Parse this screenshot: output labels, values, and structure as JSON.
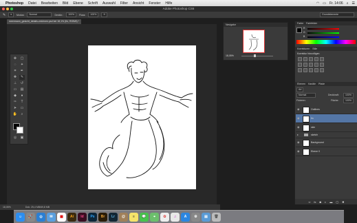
{
  "menubar": {
    "app": "Photoshop",
    "items": [
      "Datei",
      "Bearbeiten",
      "Bild",
      "Ebene",
      "Schrift",
      "Auswahl",
      "Filter",
      "Ansicht",
      "Fenster",
      "Hilfe"
    ],
    "clock": "Fr. 14:06"
  },
  "window_title": "Adobe Photoshop CS6",
  "options": {
    "modus_label": "Modus:",
    "modus_value": "Normal",
    "deckkraft_label": "Deckkr.:",
    "deckkraft_value": "100%",
    "fluss_label": "Fluss:",
    "fluss_value": "100%",
    "workspace": "Grundelemente"
  },
  "document_tab": "meermann_gesicht_details-zeichnen.psd bei 18,1% (fin, RGB/8) *",
  "status": {
    "zoom": "18,05%",
    "doc": "Dok: 25,4 MB/69,8 MB"
  },
  "navigator": {
    "title": "Navigator",
    "zoom": "18,05%"
  },
  "color_panel": {
    "tabs": [
      "Farbe",
      "Farbfelder"
    ],
    "channels": [
      "R",
      "G",
      "B"
    ]
  },
  "adjust_panel": {
    "tabs": [
      "Korrekturen",
      "Stile"
    ],
    "heading": "Korrektur hinzufügen"
  },
  "layers_panel": {
    "tabs": [
      "Ebenen",
      "Kanäle",
      "Pfade"
    ],
    "kind_label": "Art",
    "blend_mode": "Normal",
    "opacity_label": "Deckkraft:",
    "opacity_value": "100%",
    "lock_label": "Fixieren:",
    "fill_label": "Fläche:",
    "fill_value": "100%",
    "layers": [
      {
        "name": "Outlines",
        "selected": false
      },
      {
        "name": "fin",
        "selected": true
      },
      {
        "name": "skin",
        "selected": false
      },
      {
        "name": "sketch",
        "selected": false,
        "folder": true
      },
      {
        "name": "Background",
        "selected": false
      },
      {
        "name": "Ebene 0",
        "selected": false
      }
    ]
  },
  "dock_apps": [
    "Finder",
    "Launchpad",
    "Safari",
    "Mail",
    "Kalender",
    "Ai",
    "Id",
    "Ps",
    "Br",
    "Lr",
    "Kontakte",
    "Notizen",
    "Nachrichten",
    "Karten",
    "Fotos",
    "iTunes",
    "App Store",
    "Einstellungen",
    "Programme",
    "Papierkorb"
  ]
}
